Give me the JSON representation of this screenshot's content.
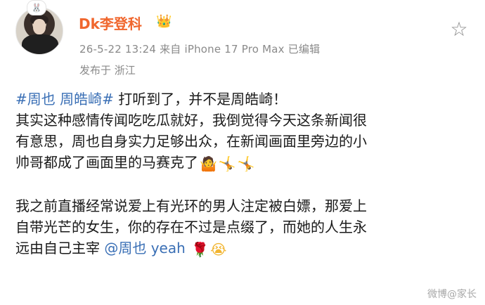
{
  "header": {
    "name": "Dk李登科",
    "time": "26-5-22 13:24",
    "via": "来自 iPhone 17 Pro Max",
    "edited": "已编辑",
    "location": "发布于 浙江"
  },
  "post": {
    "tag": "#周也 周皓崎#",
    "line1_rest": " 打听到了，并不是周皓崎！",
    "line2": "其实这种感情传闻吃吃瓜就好，我倒觉得今天这条新闻很",
    "line3": "有意思，周也自身实力足够出众，在新闻画面里旁边的小",
    "line4": "帅哥都成了画面里的马赛克了",
    "para2_line1": "我之前直播经常说爱上有光环的男人注定被白嫖，那爱上",
    "para2_line2": "自带光芒的女生，你的存在不过是点缀了，而她的人生永",
    "para2_line3": "远由自己主宰",
    "mention": "@周也 yeah"
  },
  "icons": {
    "favorite": "star-icon",
    "badge": "rabbit-badge-icon",
    "crown": "crown-icon"
  },
  "watermark": "微博@家长"
}
